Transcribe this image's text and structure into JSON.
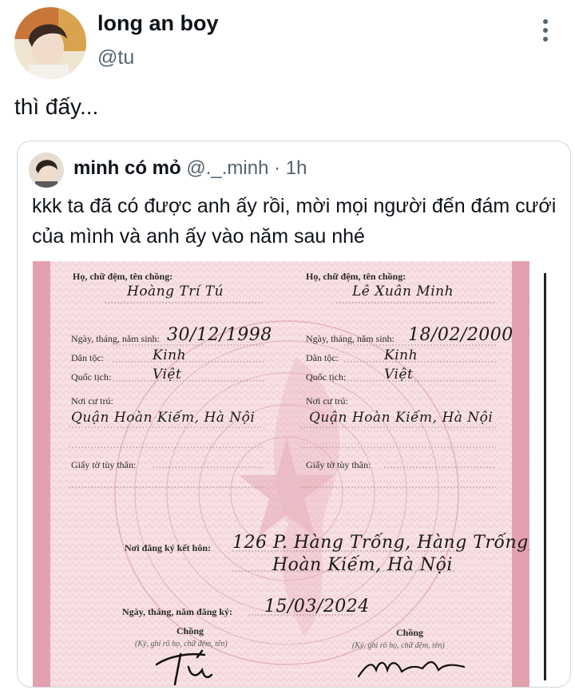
{
  "header": {
    "display_name": "long an boy",
    "handle": "@tu",
    "more_icon": "more-vertical-icon"
  },
  "tweet": {
    "text": "thì đấy..."
  },
  "quote": {
    "name": "minh có mỏ",
    "handle": "@._.minh",
    "separator": "·",
    "time": "1h",
    "text": "kkk ta đã có được anh ấy rồi, mời mọi người đến đám cưới của mình và anh ấy vào năm sau nhé"
  },
  "certificate": {
    "left": {
      "name_label": "Họ, chữ đệm, tên chồng:",
      "name_value": "Hoàng Trí Tú",
      "dob_label": "Ngày, tháng, năm sinh:",
      "dob_value": "30/12/1998",
      "ethnic_label": "Dân tộc:",
      "ethnic_value": "Kinh",
      "nationality_label": "Quốc tịch:",
      "nationality_value": "Việt",
      "residence_label": "Nơi cư trú:",
      "residence_value": "Quận Hoàn Kiếm, Hà Nội",
      "id_label": "Giấy tờ tùy thân:"
    },
    "right": {
      "name_label": "Họ, chữ đệm, tên chồng:",
      "name_value": "Lê Xuân Minh",
      "dob_label": "Ngày, tháng, năm sinh:",
      "dob_value": "18/02/2000",
      "ethnic_label": "Dân tộc:",
      "ethnic_value": "Kinh",
      "nationality_label": "Quốc tịch:",
      "nationality_value": "Việt",
      "residence_label": "Nơi cư trú:",
      "residence_value": "Quận Hoàn Kiếm, Hà Nội",
      "id_label": "Giấy tờ tùy thân:"
    },
    "registration_place_label": "Nơi đăng ký kết hôn:",
    "registration_place_line1": "126 P. Hàng Trống, Hàng Trống,",
    "registration_place_line2": "Hoàn Kiếm, Hà Nội",
    "registration_date_label": "Ngày, tháng, năm đăng ký:",
    "registration_date_value": "15/03/2024",
    "sign_left_label": "Chồng",
    "sign_left_hint": "(Ký, ghi rõ họ, chữ đệm, tên)",
    "sign_right_label": "Chồng",
    "sign_right_hint": "(Ký, ghi rõ họ, chữ đệm, tên)",
    "colors": {
      "paper": "#f6dde1",
      "pattern": "#d88a98",
      "border": "#c95a72"
    }
  }
}
